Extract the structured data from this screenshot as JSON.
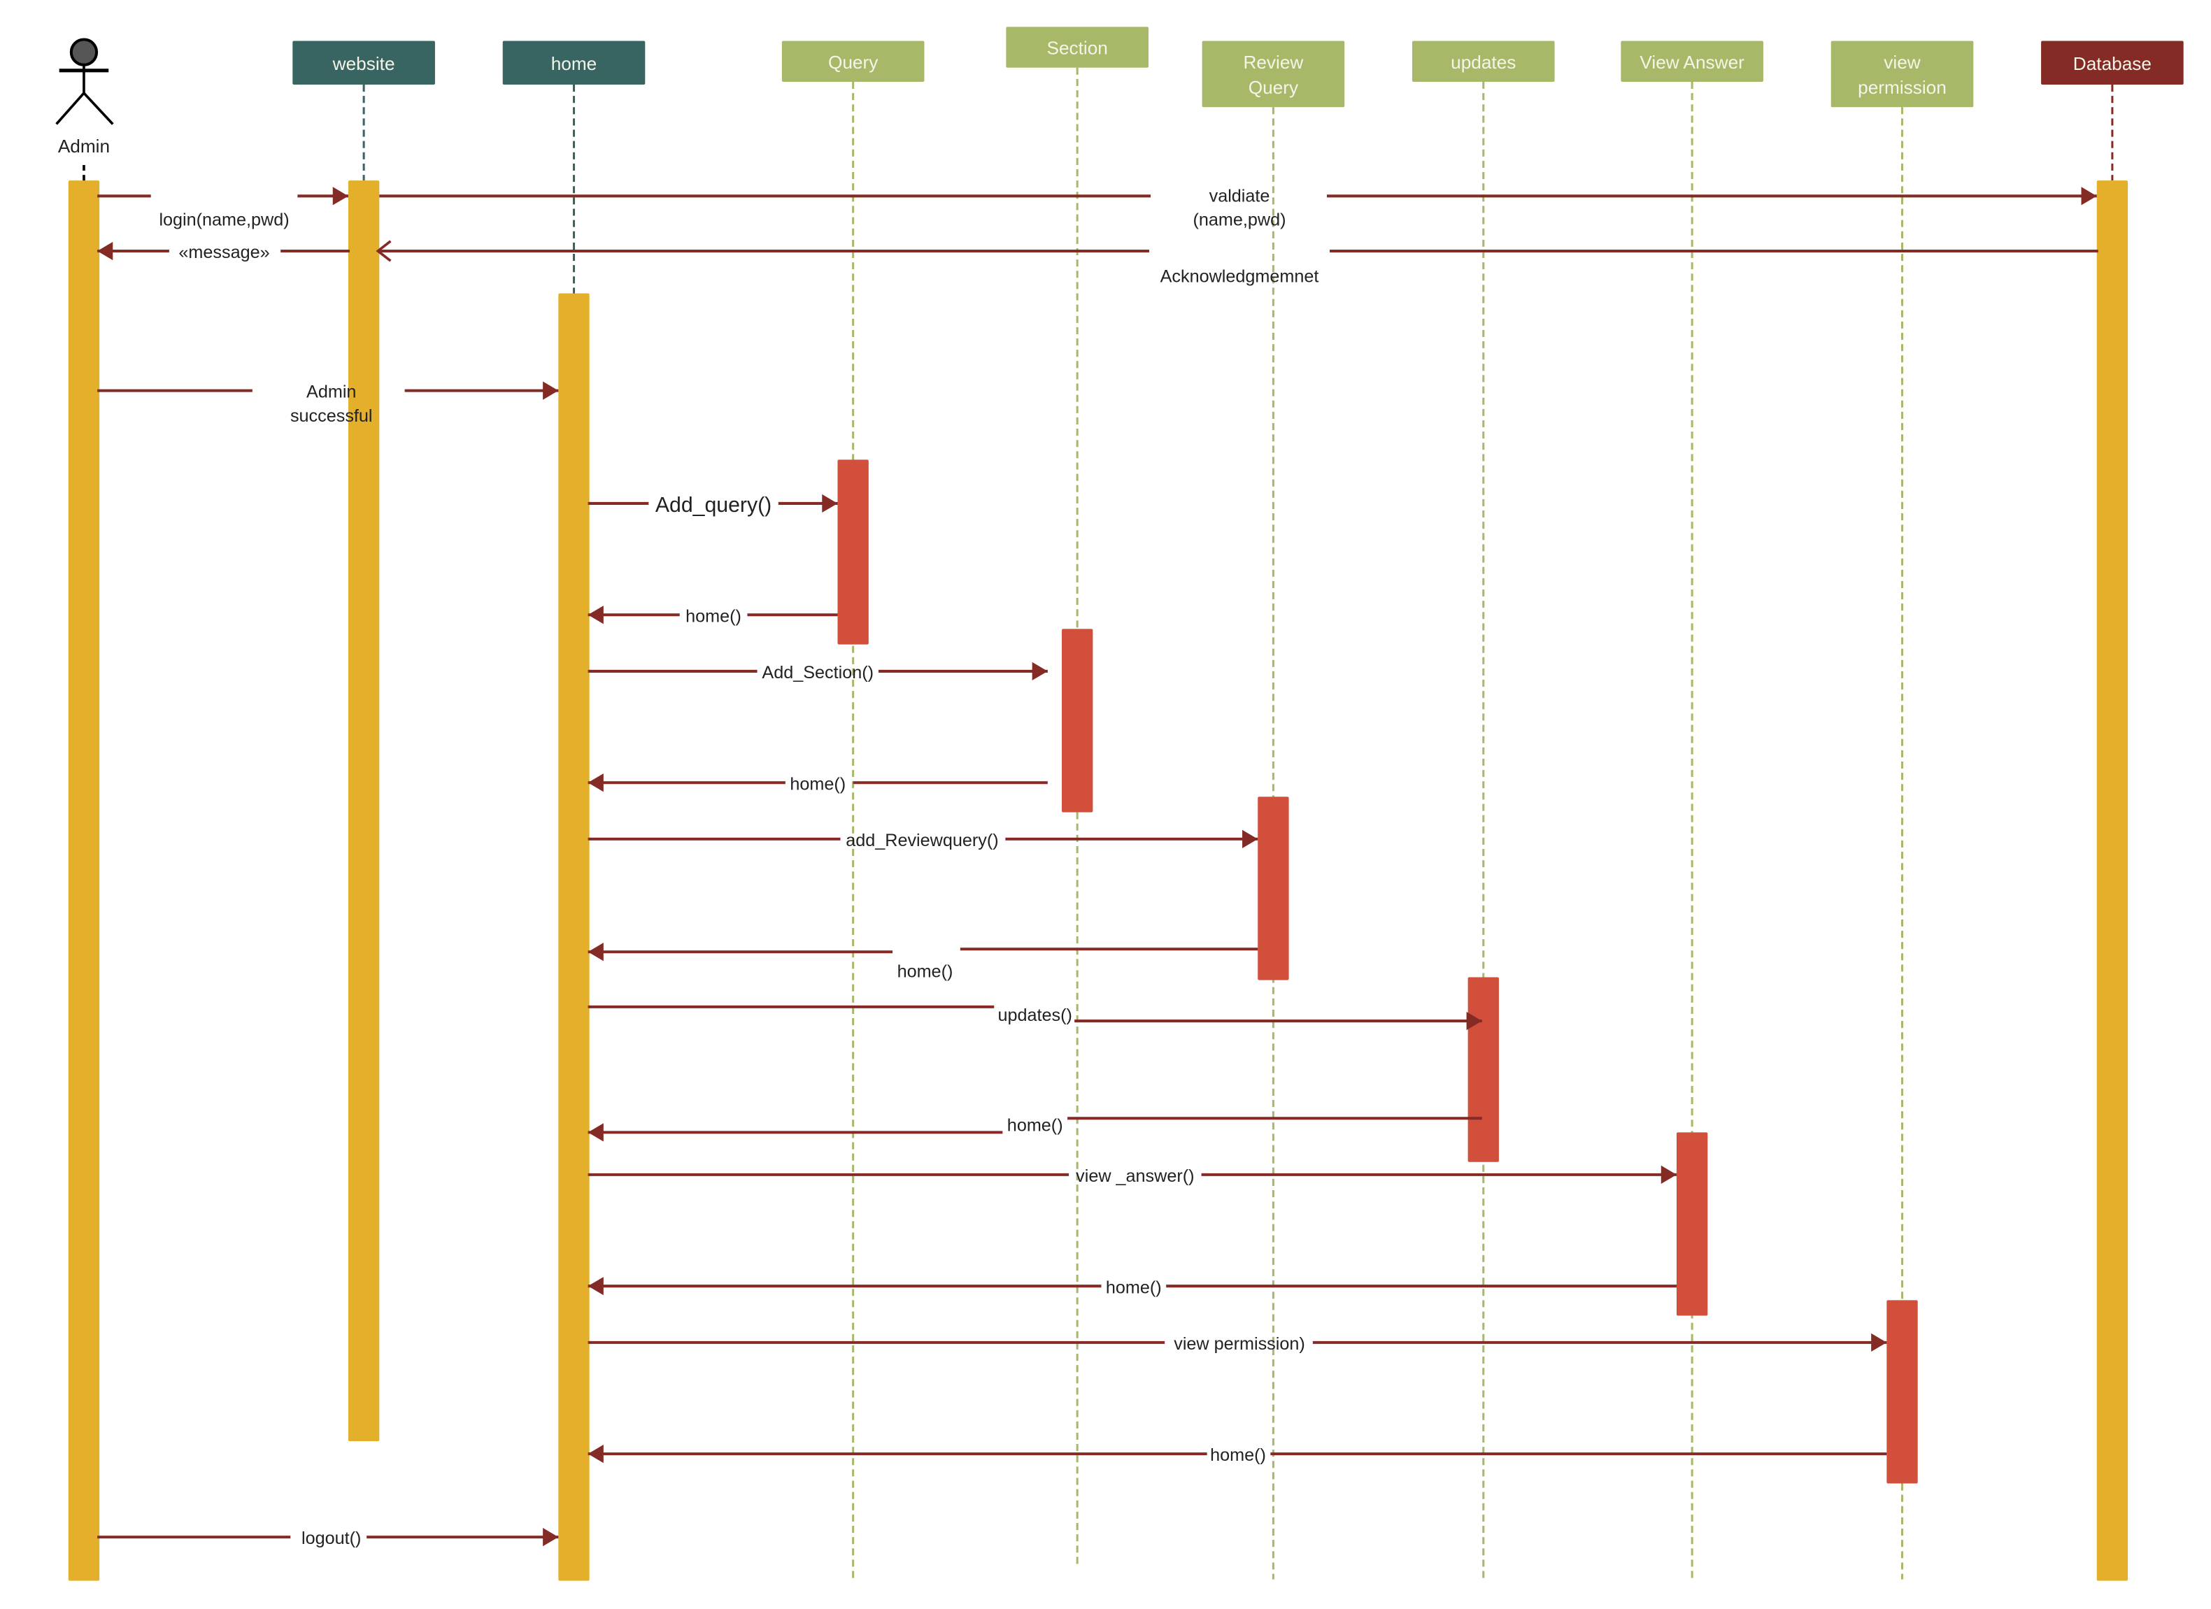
{
  "diagram": {
    "type": "UML sequence diagram",
    "colors": {
      "header_dark": "#386461",
      "header_green": "#a7b968",
      "header_db": "#832b24",
      "activation_main": "#e4b02c",
      "activation_sub": "#d24f3c",
      "message_line": "#832b24",
      "lifeline_dark": "#386461",
      "lifeline_green": "#a7b968",
      "lifeline_db": "#832b24"
    },
    "actor": {
      "label": "Admin"
    },
    "lifelines": [
      {
        "id": "website",
        "label": [
          "website"
        ],
        "style": "dark"
      },
      {
        "id": "home",
        "label": [
          "home"
        ],
        "style": "dark"
      },
      {
        "id": "query",
        "label": [
          "Query"
        ],
        "style": "green"
      },
      {
        "id": "section",
        "label": [
          "Section"
        ],
        "style": "green"
      },
      {
        "id": "review",
        "label": [
          "Review",
          "Query"
        ],
        "style": "green"
      },
      {
        "id": "updates",
        "label": [
          "updates"
        ],
        "style": "green"
      },
      {
        "id": "viewanswer",
        "label": [
          "View Answer"
        ],
        "style": "green"
      },
      {
        "id": "viewperm",
        "label": [
          "view",
          "permission"
        ],
        "style": "green"
      },
      {
        "id": "database",
        "label": [
          "Database"
        ],
        "style": "db"
      }
    ],
    "messages": [
      {
        "from": "admin",
        "to": "website",
        "label": [
          "login(name,pwd)"
        ],
        "kind": "call"
      },
      {
        "from": "website",
        "to": "database",
        "label": [
          "valdiate",
          "(name,pwd)"
        ],
        "kind": "call"
      },
      {
        "from": "database",
        "to": "website",
        "label": [
          "Acknowledgmemnet"
        ],
        "kind": "reply-open"
      },
      {
        "from": "website",
        "to": "admin",
        "label": [
          "«message»"
        ],
        "kind": "reply"
      },
      {
        "from": "admin",
        "to": "home",
        "label": [
          "Admin",
          "successful"
        ],
        "kind": "call"
      },
      {
        "from": "home",
        "to": "query",
        "label": [
          "Add_query()"
        ],
        "kind": "call"
      },
      {
        "from": "query",
        "to": "home",
        "label": [
          "home()"
        ],
        "kind": "reply"
      },
      {
        "from": "home",
        "to": "section",
        "label": [
          "Add_Section()"
        ],
        "kind": "call"
      },
      {
        "from": "section",
        "to": "home",
        "label": [
          "home()"
        ],
        "kind": "reply"
      },
      {
        "from": "home",
        "to": "review",
        "label": [
          "add_Reviewquery()"
        ],
        "kind": "call"
      },
      {
        "from": "review",
        "to": "home",
        "label": [
          "home()"
        ],
        "kind": "reply"
      },
      {
        "from": "home",
        "to": "updates",
        "label": [
          "updates()"
        ],
        "kind": "call"
      },
      {
        "from": "updates",
        "to": "home",
        "label": [
          "home()"
        ],
        "kind": "reply"
      },
      {
        "from": "home",
        "to": "viewanswer",
        "label": [
          "view _answer()"
        ],
        "kind": "call"
      },
      {
        "from": "viewanswer",
        "to": "home",
        "label": [
          "home()"
        ],
        "kind": "reply"
      },
      {
        "from": "home",
        "to": "viewperm",
        "label": [
          "view permission)"
        ],
        "kind": "call"
      },
      {
        "from": "viewperm",
        "to": "home",
        "label": [
          "home()"
        ],
        "kind": "reply"
      },
      {
        "from": "admin",
        "to": "home",
        "label": [
          "logout()"
        ],
        "kind": "call"
      }
    ]
  }
}
